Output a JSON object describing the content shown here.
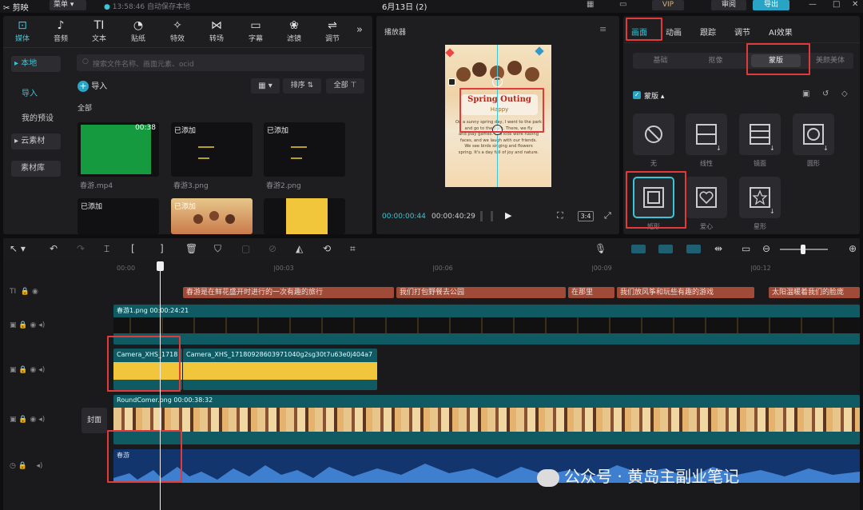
{
  "app": {
    "name": "剪映",
    "menu": "菜单",
    "autosave": "13:58:46 自动保存本地",
    "project": "6月13日 (2)",
    "vip": "VIP",
    "review": "审阅",
    "export": "导出"
  },
  "categories": [
    {
      "label": "媒体",
      "icon": "media-icon"
    },
    {
      "label": "音频",
      "icon": "audio-icon"
    },
    {
      "label": "文本",
      "icon": "text-icon"
    },
    {
      "label": "贴纸",
      "icon": "sticker-icon"
    },
    {
      "label": "特效",
      "icon": "effects-icon"
    },
    {
      "label": "转场",
      "icon": "transition-icon"
    },
    {
      "label": "字幕",
      "icon": "subtitle-icon"
    },
    {
      "label": "滤镜",
      "icon": "filter-icon"
    },
    {
      "label": "调节",
      "icon": "adjust-icon"
    }
  ],
  "sidebar": {
    "local": "本地",
    "import": "导入",
    "presets": "我的预设",
    "cloud": "云素材",
    "library": "素材库"
  },
  "media": {
    "search_placeholder": "搜索文件名称、画面元素、ocid",
    "import": "导入",
    "sort": "排序",
    "all": "全部",
    "section": "全部",
    "items": [
      {
        "badge": "00:38",
        "name": "春游.mp4",
        "color": "#159a3f"
      },
      {
        "badge": "已添加",
        "name": "春游3.png",
        "color": "#101014"
      },
      {
        "badge": "已添加",
        "name": "春游2.png",
        "color": "#101014"
      },
      {
        "badge": "已添加",
        "name": "",
        "color": "#101014"
      },
      {
        "badge": "已添加",
        "name": "",
        "color": "#d9a55a"
      },
      {
        "badge": "",
        "name": "",
        "color": "#f2c63a"
      }
    ]
  },
  "player": {
    "title": "播放器",
    "current": "00:00:00:44",
    "total": "00:00:40:29",
    "ratio": "3:4",
    "poster_title": "Spring Outing",
    "poster_sub": "Happy",
    "poster_lines": [
      "On a sunny spring day, I went to the park",
      "and go to the park. There, we fly",
      "and play games. The kids were having",
      "faces, and we laugh with our friends.",
      "We see birds singing and flowers",
      "spring. It's a day full of joy and nature."
    ]
  },
  "inspector": {
    "tabs": [
      "画面",
      "动画",
      "跟踪",
      "调节",
      "AI效果"
    ],
    "subtabs": [
      "基础",
      "抠像",
      "蒙版",
      "美颜美体"
    ],
    "mask_section": "蒙版",
    "masks": [
      {
        "label": "无",
        "icon": "none-mask-icon"
      },
      {
        "label": "线性",
        "icon": "linear-mask-icon"
      },
      {
        "label": "镜面",
        "icon": "mirror-mask-icon"
      },
      {
        "label": "圆形",
        "icon": "circle-mask-icon"
      },
      {
        "label": "矩形",
        "icon": "rect-mask-icon"
      },
      {
        "label": "爱心",
        "icon": "heart-mask-icon"
      },
      {
        "label": "星形",
        "icon": "star-mask-icon"
      }
    ]
  },
  "timeline": {
    "ticks": [
      "00:00",
      "|00:03",
      "|00:06",
      "|00:09",
      "|00:12"
    ],
    "cover": "封面",
    "subtitles": [
      "春游是在鲜花盛开时进行的一次有趣的旅行",
      "我们打包野餐去公园",
      "在那里",
      "我们放风筝和玩些有趣的游戏",
      "太阳温暖着我们的脸庞"
    ],
    "track1_label": "春游1.png 00:00:24:21",
    "track2_clip1": "Camera_XHS_1718",
    "track2_clip2": "Camera_XHS_17180928603971040g2sg30t7u63e0j404a7",
    "track3_label": "RoundComer.png 00:00:38:32",
    "audio_label": "春游"
  },
  "watermark": "公众号 · 黄岛主副业笔记"
}
